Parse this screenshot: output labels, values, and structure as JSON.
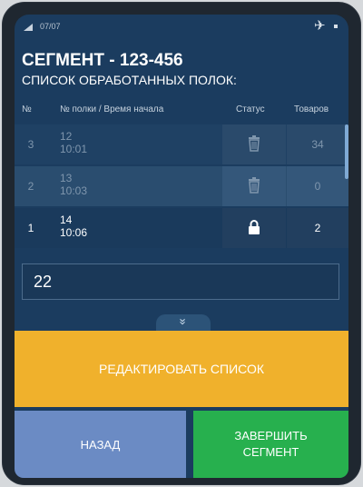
{
  "status": {
    "time": "07/07",
    "icons": [
      "signal-icon",
      "airplane-icon",
      "battery-icon"
    ]
  },
  "header": {
    "title": "СЕГМЕНТ - 123-456",
    "subtitle": "СПИСОК ОБРАБОТАННЫХ ПОЛОК:"
  },
  "table": {
    "columns": [
      "№",
      "№ полки / Время начала",
      "Статус",
      "Товаров"
    ],
    "rows": [
      {
        "num": "3",
        "shelf": "12",
        "time": "10:01",
        "status": "trash-icon",
        "count": "34"
      },
      {
        "num": "2",
        "shelf": "13",
        "time": "10:03",
        "status": "trash-icon",
        "count": "0"
      },
      {
        "num": "1",
        "shelf": "14",
        "time": "10:06",
        "status": "lock-icon",
        "count": "2"
      }
    ]
  },
  "input": {
    "value": "22"
  },
  "expand": {
    "icon": "chevron-double-down-icon",
    "glyph": "»"
  },
  "buttons": {
    "edit": "РЕДАКТИРОВАТЬ СПИСОК",
    "back": "НАЗАД",
    "finish_line1": "ЗАВЕРШИТЬ",
    "finish_line2": "СЕГМЕНТ"
  },
  "colors": {
    "background": "#1b3c5f",
    "edit_button": "#f0b12c",
    "back_button": "#6b8bc4",
    "finish_button": "#27b04e"
  }
}
